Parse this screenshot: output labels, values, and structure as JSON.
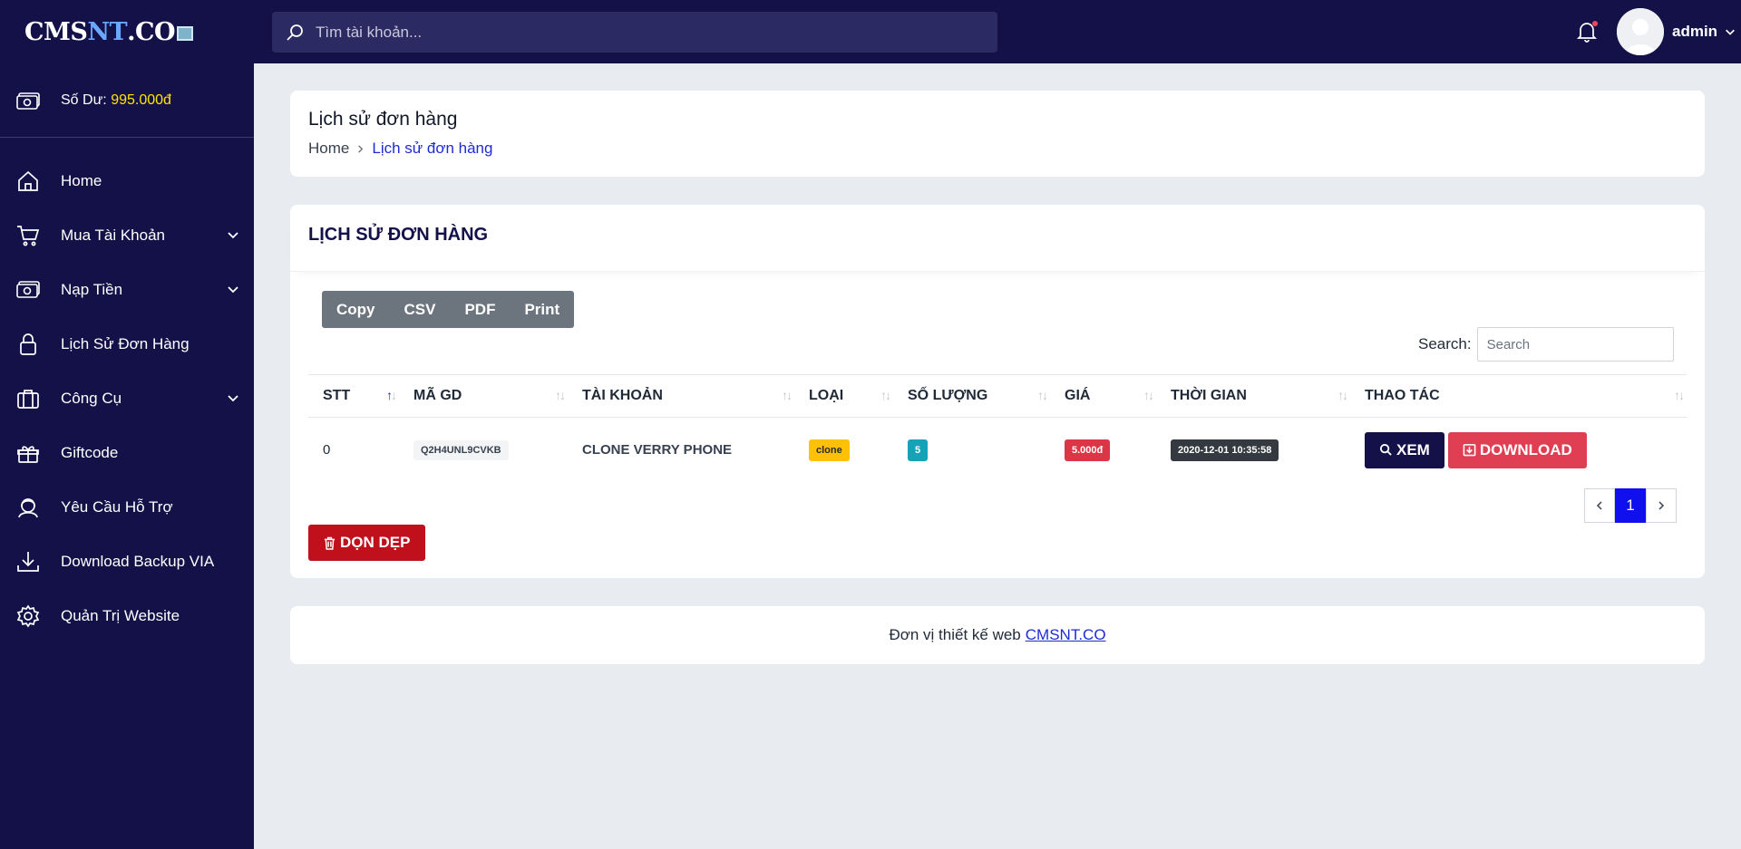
{
  "brand": {
    "logo_part1": "CMS",
    "logo_part2": "NT",
    "logo_part3": ".CO"
  },
  "sidebar": {
    "balance_label": "Số Dư:",
    "balance_amount": "995.000đ",
    "items": [
      {
        "label": "Home",
        "icon": "home-icon",
        "has_submenu": false
      },
      {
        "label": "Mua Tài Khoản",
        "icon": "cart-icon",
        "has_submenu": true
      },
      {
        "label": "Nạp Tiền",
        "icon": "money-icon",
        "has_submenu": true
      },
      {
        "label": "Lịch Sử Đơn Hàng",
        "icon": "lock-icon",
        "has_submenu": false
      },
      {
        "label": "Công Cụ",
        "icon": "briefcase-icon",
        "has_submenu": true
      },
      {
        "label": "Giftcode",
        "icon": "gift-icon",
        "has_submenu": false
      },
      {
        "label": "Yêu Cầu Hỗ Trợ",
        "icon": "support-icon",
        "has_submenu": false
      },
      {
        "label": "Download Backup VIA",
        "icon": "download-icon",
        "has_submenu": false
      },
      {
        "label": "Quản Trị Website",
        "icon": "gear-icon",
        "has_submenu": false
      }
    ]
  },
  "topbar": {
    "search_placeholder": "Tìm tài khoản...",
    "username": "admin"
  },
  "page": {
    "title": "Lịch sử đơn hàng",
    "breadcrumb": {
      "home": "Home",
      "current": "Lịch sử đơn hàng"
    }
  },
  "orders": {
    "card_title": "LỊCH SỬ ĐƠN HÀNG",
    "export_buttons": [
      "Copy",
      "CSV",
      "PDF",
      "Print"
    ],
    "search_label": "Search:",
    "search_placeholder": "Search",
    "columns": [
      "STT",
      "MÃ GD",
      "TÀI KHOẢN",
      "LOẠI",
      "SỐ LƯỢNG",
      "GIÁ",
      "THỜI GIAN",
      "THAO TÁC"
    ],
    "rows": [
      {
        "stt": "0",
        "ma_gd": "Q2H4UNL9CVKB",
        "tai_khoan": "CLONE VERRY PHONE",
        "loai": "clone",
        "so_luong": "5",
        "gia": "5.000đ",
        "thoi_gian": "2020-12-01 10:35:58",
        "view_label": "XEM",
        "download_label": "DOWNLOAD"
      }
    ],
    "pagination": {
      "current": "1"
    },
    "clean_button": "DỌN DẸP"
  },
  "footer": {
    "text": "Đơn vị thiết kế web",
    "link": "CMSNT.CO"
  },
  "colors": {
    "sidebar_bg": "#131148",
    "accent_blue": "#1d2bd6",
    "balance": "#ffe600",
    "danger": "#dc3545"
  }
}
